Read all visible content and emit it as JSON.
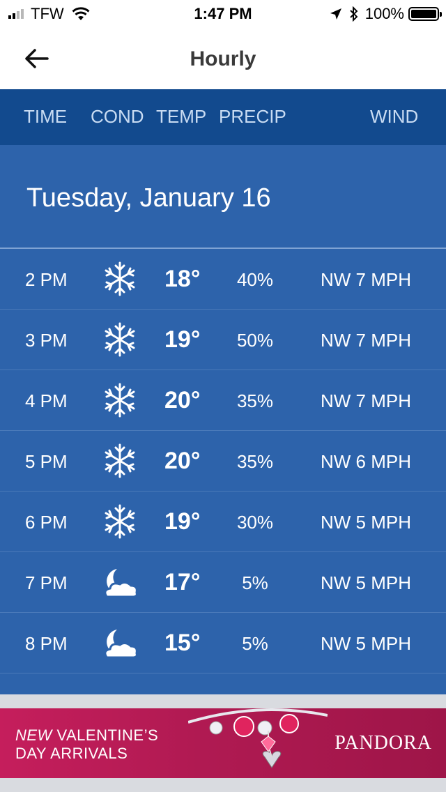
{
  "status_bar": {
    "carrier": "TFW",
    "time": "1:47 PM",
    "battery_percent": "100%",
    "battery_level": 1.0
  },
  "header": {
    "title": "Hourly"
  },
  "columns": {
    "time": "TIME",
    "cond": "COND",
    "temp": "TEMP",
    "precip": "PRECIP",
    "wind": "WIND"
  },
  "day": {
    "heading": "Tuesday, January 16"
  },
  "hours": [
    {
      "time": "2 PM",
      "icon": "snow-icon",
      "temp": "18°",
      "precip": "40%",
      "wind": "NW 7 MPH"
    },
    {
      "time": "3 PM",
      "icon": "snow-icon",
      "temp": "19°",
      "precip": "50%",
      "wind": "NW 7 MPH"
    },
    {
      "time": "4 PM",
      "icon": "snow-icon",
      "temp": "20°",
      "precip": "35%",
      "wind": "NW 7 MPH"
    },
    {
      "time": "5 PM",
      "icon": "snow-icon",
      "temp": "20°",
      "precip": "35%",
      "wind": "NW 6 MPH"
    },
    {
      "time": "6 PM",
      "icon": "snow-icon",
      "temp": "19°",
      "precip": "30%",
      "wind": "NW 5 MPH"
    },
    {
      "time": "7 PM",
      "icon": "night-partly-cloudy-icon",
      "temp": "17°",
      "precip": "5%",
      "wind": "NW 5 MPH"
    },
    {
      "time": "8 PM",
      "icon": "night-partly-cloudy-icon",
      "temp": "15°",
      "precip": "5%",
      "wind": "NW 5 MPH"
    }
  ],
  "ad": {
    "line1_accent": "NEW",
    "line1_rest": " VALENTINE’S",
    "line2": "DAY ARRIVALS",
    "brand": "PANDORA"
  },
  "colors": {
    "column_header_bg": "#124a8e",
    "list_bg": "#2d63ab",
    "ad_bg": "#c51e5c"
  }
}
